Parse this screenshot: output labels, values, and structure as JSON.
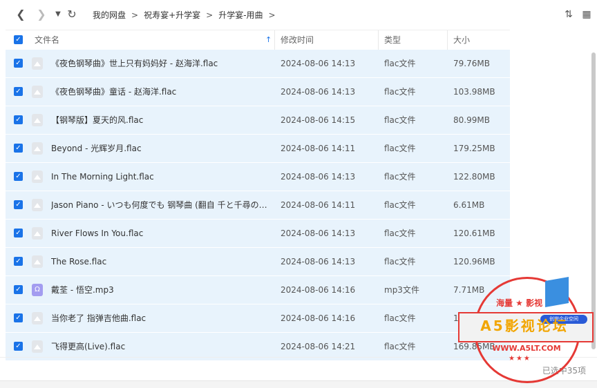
{
  "toolbar": {
    "back_icon": "chevron-left-icon",
    "forward_icon": "chevron-right-icon",
    "dropdown_icon": "caret-down-icon",
    "refresh_icon": "refresh-icon",
    "sort_icon": "sort-icon",
    "grid_icon": "grid-view-icon"
  },
  "breadcrumb": [
    "我的网盘",
    "祝寿宴+升学宴",
    "升学宴-用曲"
  ],
  "columns": {
    "name": "文件名",
    "modified": "修改时间",
    "type": "类型",
    "size": "大小"
  },
  "files": [
    {
      "name": "《夜色钢琴曲》世上只有妈妈好 - 赵海洋.flac",
      "modified": "2024-08-06 14:13",
      "type": "flac文件",
      "size": "79.76MB",
      "icon": "file-icon"
    },
    {
      "name": "《夜色钢琴曲》童话 - 赵海洋.flac",
      "modified": "2024-08-06 14:13",
      "type": "flac文件",
      "size": "103.98MB",
      "icon": "file-icon"
    },
    {
      "name": "【钢琴版】夏天的风.flac",
      "modified": "2024-08-06 14:15",
      "type": "flac文件",
      "size": "80.99MB",
      "icon": "file-icon"
    },
    {
      "name": "Beyond - 光辉岁月.flac",
      "modified": "2024-08-06 14:11",
      "type": "flac文件",
      "size": "179.25MB",
      "icon": "file-icon"
    },
    {
      "name": "In The Morning Light.flac",
      "modified": "2024-08-06 14:13",
      "type": "flac文件",
      "size": "122.80MB",
      "icon": "file-icon"
    },
    {
      "name": "Jason Piano - いつも何度でも 钢琴曲 (翻自 千と千尋の…",
      "modified": "2024-08-06 14:11",
      "type": "flac文件",
      "size": "6.61MB",
      "icon": "file-icon"
    },
    {
      "name": "River Flows In You.flac",
      "modified": "2024-08-06 14:13",
      "type": "flac文件",
      "size": "120.61MB",
      "icon": "file-icon"
    },
    {
      "name": "The Rose.flac",
      "modified": "2024-08-06 14:13",
      "type": "flac文件",
      "size": "120.96MB",
      "icon": "file-icon"
    },
    {
      "name": "戴荃 - 悟空.mp3",
      "modified": "2024-08-06 14:16",
      "type": "mp3文件",
      "size": "7.71MB",
      "icon": "audio-file-icon"
    },
    {
      "name": "当你老了 指弹吉他曲.flac",
      "modified": "2024-08-06 14:16",
      "type": "flac文件",
      "size": "149.68MB",
      "icon": "file-icon"
    },
    {
      "name": "飞得更高(Live).flac",
      "modified": "2024-08-06 14:21",
      "type": "flac文件",
      "size": "169.85MB",
      "icon": "file-icon"
    }
  ],
  "status": "已选中35项",
  "watermark": {
    "top": "海量 ★ 影视",
    "title": "A5影视论坛",
    "tag": "创世企业空间",
    "url": "WWW.A5LT.COM",
    "stars": "★★★"
  },
  "colors": {
    "accent": "#1a73e8",
    "row_selected": "#e8f3fc",
    "stamp": "#e53935"
  }
}
